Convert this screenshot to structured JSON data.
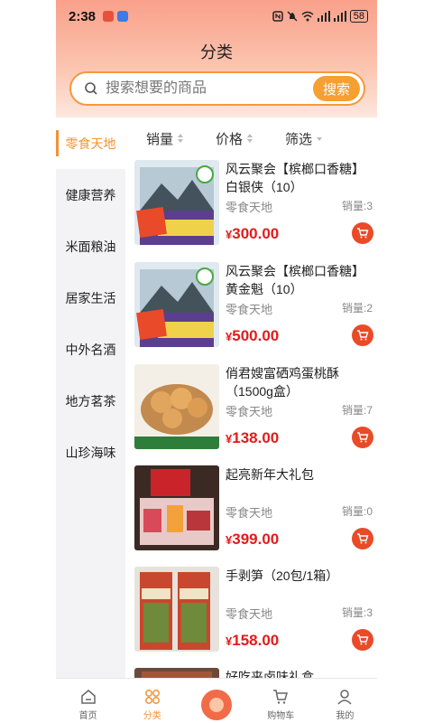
{
  "status_bar": {
    "time": "2:38",
    "battery": "58"
  },
  "page_title": "分类",
  "search": {
    "placeholder": "搜索想要的商品",
    "button_label": "搜索"
  },
  "sidebar": {
    "items": [
      {
        "label": "零食天地",
        "active": true
      },
      {
        "label": "健康营养",
        "active": false
      },
      {
        "label": "米面粮油",
        "active": false
      },
      {
        "label": "居家生活",
        "active": false
      },
      {
        "label": "中外名酒",
        "active": false
      },
      {
        "label": "地方茗茶",
        "active": false
      },
      {
        "label": "山珍海味",
        "active": false
      }
    ]
  },
  "sort_bar": {
    "sales_label": "销量",
    "price_label": "价格",
    "filter_label": "筛选"
  },
  "products": [
    {
      "name": "风云聚会【槟榔口香糖】白银侠（10）",
      "category": "零食天地",
      "sales": "销量:3",
      "currency": "¥",
      "price": "300.00"
    },
    {
      "name": "风云聚会【槟榔口香糖】黄金魁（10）",
      "category": "零食天地",
      "sales": "销量:2",
      "currency": "¥",
      "price": "500.00"
    },
    {
      "name": "俏君嫂富硒鸡蛋桃酥（1500g盒）",
      "category": "零食天地",
      "sales": "销量:7",
      "currency": "¥",
      "price": "138.00"
    },
    {
      "name": "起亮新年大礼包",
      "category": "零食天地",
      "sales": "销量:0",
      "currency": "¥",
      "price": "399.00"
    },
    {
      "name": "手剥笋（20包/1箱）",
      "category": "零食天地",
      "sales": "销量:3",
      "currency": "¥",
      "price": "158.00"
    },
    {
      "name": "好吃来卤味礼盒",
      "category": "",
      "sales": "",
      "currency": "",
      "price": ""
    }
  ],
  "tabbar": {
    "items": [
      {
        "label": "首页",
        "icon": "home-icon"
      },
      {
        "label": "分类",
        "icon": "category-icon"
      },
      {
        "label": "",
        "icon": "center-icon"
      },
      {
        "label": "购物车",
        "icon": "cart-icon"
      },
      {
        "label": "我的",
        "icon": "user-icon"
      }
    ]
  },
  "colors": {
    "accent": "#f39233",
    "price": "#e31b1b",
    "cart_button": "#e94a28",
    "search_border": "#f39a3b"
  }
}
